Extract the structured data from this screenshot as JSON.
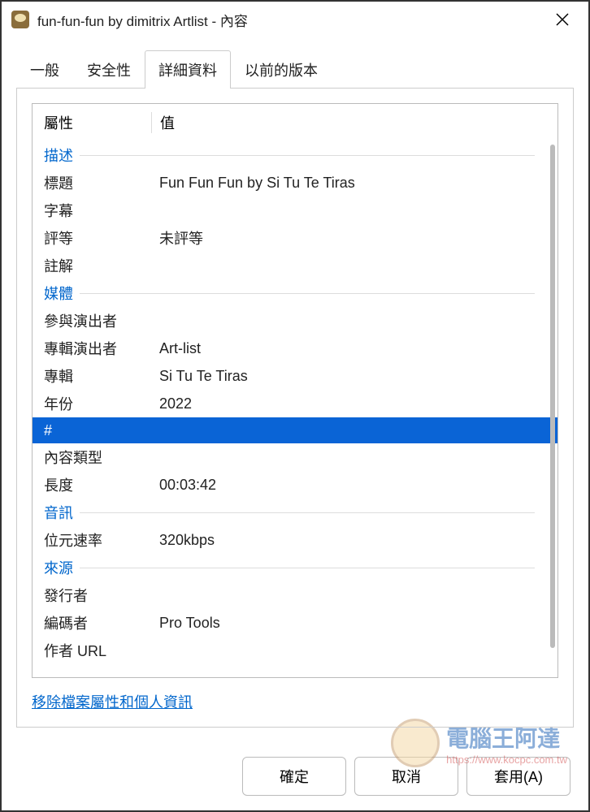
{
  "titlebar": {
    "title": "fun-fun-fun by dimitrix Artlist - 內容"
  },
  "tabs": [
    {
      "label": "一般"
    },
    {
      "label": "安全性"
    },
    {
      "label": "詳細資料"
    },
    {
      "label": "以前的版本"
    }
  ],
  "activeTab": 2,
  "columns": {
    "property": "屬性",
    "value": "值"
  },
  "sections": [
    {
      "title": "描述",
      "rows": [
        {
          "name": "標題",
          "value": "Fun Fun Fun by Si Tu Te Tiras",
          "selected": false
        },
        {
          "name": "字幕",
          "value": "",
          "selected": false
        },
        {
          "name": "評等",
          "value": "未評等",
          "selected": false
        },
        {
          "name": "註解",
          "value": "",
          "selected": false
        }
      ]
    },
    {
      "title": "媒體",
      "rows": [
        {
          "name": "參與演出者",
          "value": "",
          "selected": false
        },
        {
          "name": "專輯演出者",
          "value": "Art-list",
          "selected": false
        },
        {
          "name": "專輯",
          "value": "Si Tu Te Tiras",
          "selected": false
        },
        {
          "name": "年份",
          "value": "2022",
          "selected": false
        },
        {
          "name": "#",
          "value": "",
          "selected": true
        },
        {
          "name": "內容類型",
          "value": "",
          "selected": false
        },
        {
          "name": "長度",
          "value": "00:03:42",
          "selected": false
        }
      ]
    },
    {
      "title": "音訊",
      "rows": [
        {
          "name": "位元速率",
          "value": "320kbps",
          "selected": false
        }
      ]
    },
    {
      "title": "來源",
      "rows": [
        {
          "name": "發行者",
          "value": "",
          "selected": false
        },
        {
          "name": "編碼者",
          "value": "Pro Tools",
          "selected": false
        },
        {
          "name": "作者 URL",
          "value": "",
          "selected": false
        }
      ]
    }
  ],
  "removeLink": "移除檔案屬性和個人資訊",
  "buttons": {
    "ok": "確定",
    "cancel": "取消",
    "apply": "套用(A)"
  },
  "watermark": {
    "main": "電腦王阿達",
    "sub": "https://www.kocpc.com.tw"
  }
}
